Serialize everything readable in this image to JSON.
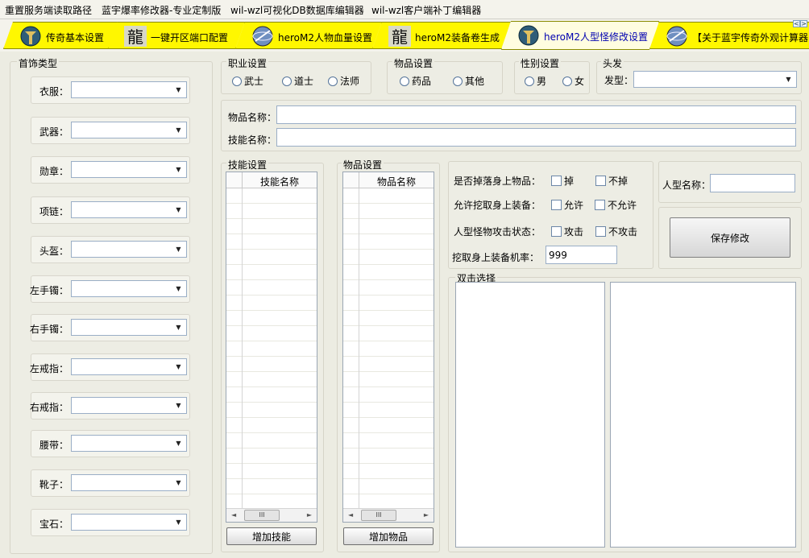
{
  "menubar": {
    "items": [
      "重置服务端读取路径",
      "蓝宇爆率修改器-专业定制版",
      "wil-wzl可视化DB数据库编辑器",
      "wil-wzl客户端补丁编辑器"
    ]
  },
  "tabs": [
    {
      "label": "传奇基本设置",
      "icon": "legend-logo-icon"
    },
    {
      "label": "一键开区端口配置",
      "icon": "dragon-glyph-icon"
    },
    {
      "label": "heroM2人物血量设置",
      "icon": "globe-icon"
    },
    {
      "label": "heroM2装备卷生成",
      "icon": "dragon-glyph-icon"
    },
    {
      "label": "heroM2人型怪修改设置",
      "icon": "legend-logo-icon"
    },
    {
      "label": "【关于蓝宇传奇外观计算器",
      "icon": "globe-icon"
    }
  ],
  "tabs_nav": {
    "left": "<",
    "right": ">"
  },
  "accessory": {
    "title": "首饰类型",
    "fields": [
      "衣服：",
      "武器：",
      "勋章：",
      "项链：",
      "头盔：",
      "左手镯：",
      "右手镯：",
      "左戒指：",
      "右戒指：",
      "腰带：",
      "靴子：",
      "宝石："
    ]
  },
  "profession": {
    "title": "职业设置",
    "options": [
      "武士",
      "道士",
      "法师"
    ]
  },
  "itemtype": {
    "title": "物品设置",
    "options": [
      "药品",
      "其他"
    ]
  },
  "gender": {
    "title": "性别设置",
    "options": [
      "男",
      "女"
    ]
  },
  "hair": {
    "title": "头发",
    "label": "发型："
  },
  "names": {
    "item_label": "物品名称：",
    "skill_label": "技能名称："
  },
  "skills": {
    "title": "技能设置",
    "column": "技能名称",
    "add_button": "增加技能",
    "scroll_thumb": "III"
  },
  "items": {
    "title": "物品设置",
    "column": "物品名称",
    "add_button": "增加物品",
    "scroll_thumb": "III"
  },
  "options": {
    "drop_label": "是否掉落身上物品：",
    "drop_yes": "掉",
    "drop_no": "不掉",
    "dig_label": "允许挖取身上装备：",
    "dig_yes": "允许",
    "dig_no": "不允许",
    "attack_label": "人型怪物攻击状态：",
    "attack_yes": "攻击",
    "attack_no": "不攻击",
    "rate_label": "挖取身上装备机率：",
    "rate_value": "999"
  },
  "monster": {
    "name_label": "人型名称：",
    "save_button": "保存修改"
  },
  "dblclick": {
    "title": "双击选择"
  }
}
